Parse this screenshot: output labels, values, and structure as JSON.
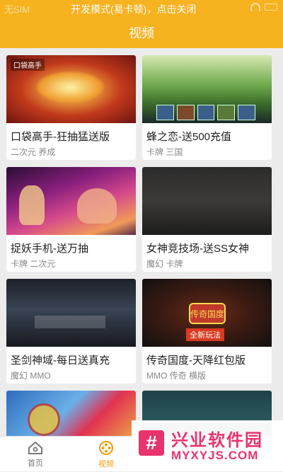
{
  "status_bar": {
    "carrier": "无SIM",
    "dev_notice": "开发模式(易卡顿)，点击关闭"
  },
  "header": {
    "title": "视频"
  },
  "games": [
    {
      "title": "口袋高手-狂抽猛送版",
      "tags": "二次元 养成",
      "badge": "口袋高手"
    },
    {
      "title": "蜂之恋-送500充值",
      "tags": "卡牌 三国"
    },
    {
      "title": "捉妖手机-送万抽",
      "tags": "卡牌 二次元"
    },
    {
      "title": "女神竞技场-送SS女神",
      "tags": "魔幻 卡牌"
    },
    {
      "title": "圣剑神域-每日送真充",
      "tags": "魔幻 MMO"
    },
    {
      "title": "传奇国度-天降红包版",
      "tags": "MMO 传奇 横版",
      "emblem": "传奇国度",
      "emblem_sub": "全新玩法"
    },
    {
      "title": "",
      "tags": ""
    },
    {
      "title": "",
      "tags": ""
    }
  ],
  "tabs": {
    "home": "首页",
    "video": "视频"
  },
  "watermark": {
    "logo": "#",
    "name": "兴业软件园",
    "url": "MYXYJS.COM"
  },
  "colors": {
    "accent": "#f7b21f",
    "active_tab": "#f39c12",
    "watermark": "#e8336d"
  }
}
